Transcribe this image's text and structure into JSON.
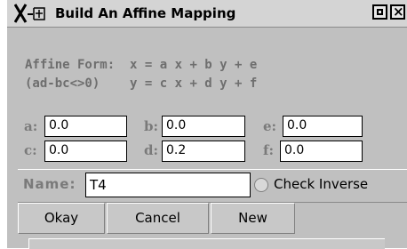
{
  "window": {
    "title": "Build An Affine Mapping"
  },
  "affine_form": {
    "line1_label": "Affine Form:",
    "line1_eq": "x = a x + b y + e",
    "line2_label": "(ad-bc<>0)",
    "line2_eq": "y = c x + d y + f"
  },
  "params": {
    "a": {
      "label": "a:",
      "value": "0.0"
    },
    "b": {
      "label": "b:",
      "value": "0.0"
    },
    "e": {
      "label": "e:",
      "value": "0.0"
    },
    "c": {
      "label": "c:",
      "value": "0.0"
    },
    "d": {
      "label": "d:",
      "value": "0.2"
    },
    "f": {
      "label": "f:",
      "value": "0.0"
    }
  },
  "name": {
    "label": "Name:",
    "value": "T4"
  },
  "check_inverse": {
    "label": "Check Inverse",
    "checked": false
  },
  "buttons": {
    "okay": "Okay",
    "cancel": "Cancel",
    "new": "New"
  },
  "icons": {
    "app": "x-window-icon",
    "maximize": "maximize-icon",
    "close": "close-icon"
  }
}
